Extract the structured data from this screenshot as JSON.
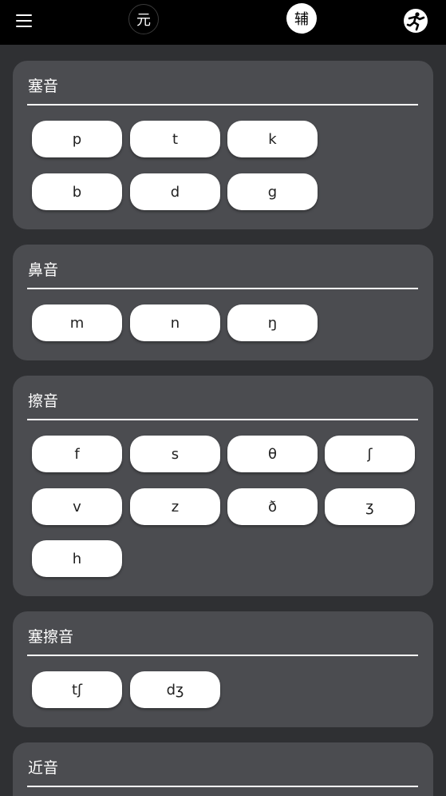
{
  "header": {
    "tabs": [
      {
        "label": "元",
        "active": false
      },
      {
        "label": "辅",
        "active": true
      }
    ],
    "menu_icon": "hamburger-menu-icon",
    "action_icon": "runner-icon"
  },
  "colors": {
    "topbar": "#000000",
    "background": "#2f3033",
    "card": "#4b4c50",
    "chip": "#ffffff",
    "text_light": "#ffffff",
    "text_dark": "#222222"
  },
  "sections": [
    {
      "title": "塞音",
      "sounds": [
        "p",
        "t",
        "k",
        "b",
        "d",
        "g"
      ]
    },
    {
      "title": "鼻音",
      "sounds": [
        "m",
        "n",
        "ŋ"
      ]
    },
    {
      "title": "擦音",
      "sounds": [
        "f",
        "s",
        "θ",
        "ʃ",
        "v",
        "z",
        "ð",
        "ʒ",
        "h"
      ]
    },
    {
      "title": "塞擦音",
      "sounds": [
        "tʃ",
        "dʒ"
      ]
    },
    {
      "title": "近音",
      "sounds": []
    }
  ]
}
